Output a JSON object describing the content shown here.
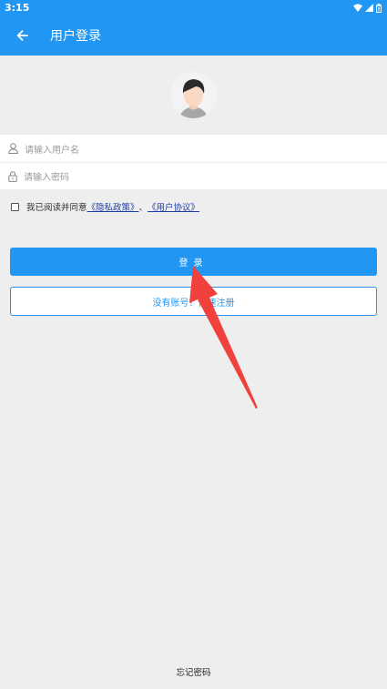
{
  "status_bar": {
    "time": "3:15"
  },
  "app_bar": {
    "title": "用户登录"
  },
  "form": {
    "username_placeholder": "请输入用户名",
    "password_placeholder": "请输入密码"
  },
  "agreement": {
    "prefix": "我已阅读并同意",
    "privacy_link": "《隐私政策》",
    "separator": "、",
    "terms_link": "《用户协议》"
  },
  "buttons": {
    "login": "登录",
    "register": "没有账号？快速注册"
  },
  "footer": {
    "forgot": "忘记密码"
  },
  "colors": {
    "primary": "#2196f3",
    "annotation_arrow": "#f0413d"
  }
}
